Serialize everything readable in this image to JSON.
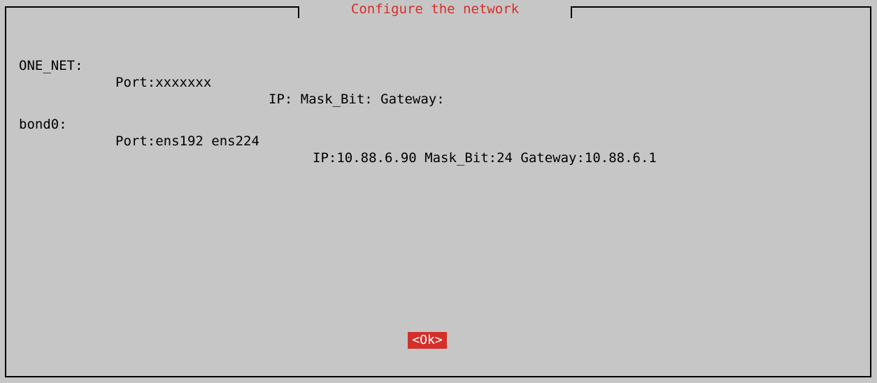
{
  "dialog": {
    "title": "Configure the network",
    "title_color": "#d42f2a",
    "background_color": "#c6c6c6"
  },
  "interfaces": [
    {
      "name": "ONE_NET:",
      "port": "Port:xxxxxxx",
      "addressing": "IP: Mask_Bit: Gateway:"
    },
    {
      "name": "bond0:",
      "port": "Port:ens192 ens224",
      "addressing": "IP:10.88.6.90 Mask_Bit:24 Gateway:10.88.6.1"
    }
  ],
  "buttons": {
    "ok_label": "<Ok>",
    "ok_color": "#d42f2a"
  }
}
